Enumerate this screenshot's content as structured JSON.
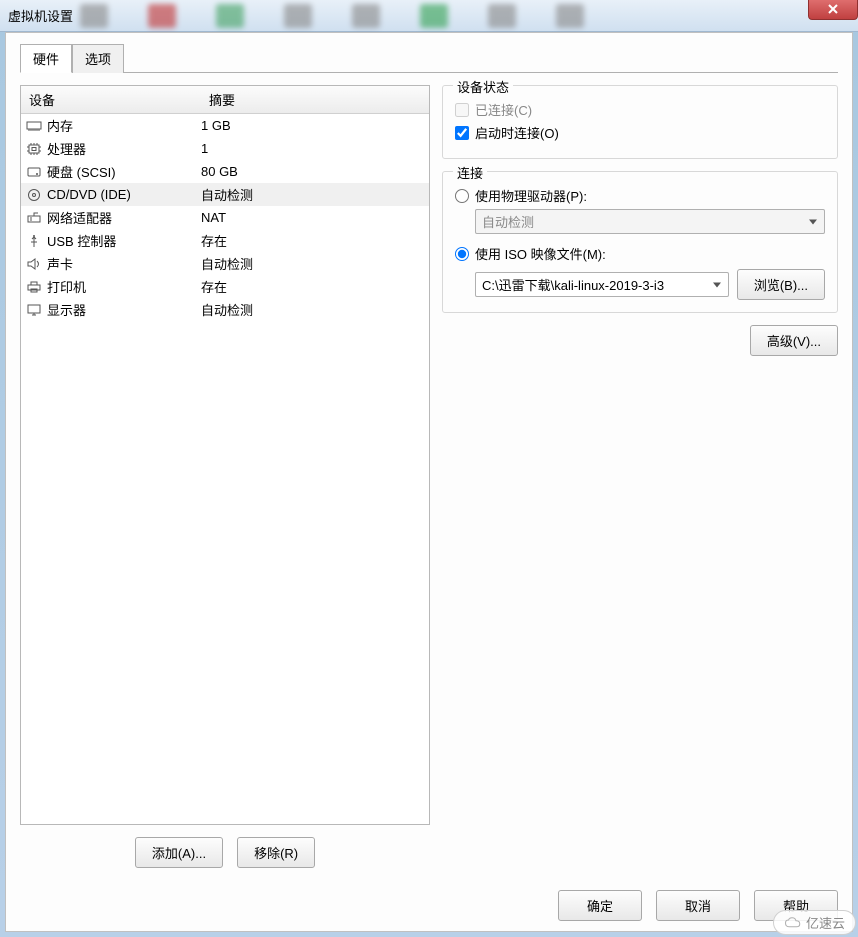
{
  "window": {
    "title": "虚拟机设置"
  },
  "tabs": {
    "hardware": "硬件",
    "options": "选项"
  },
  "deviceListHeaders": {
    "device": "设备",
    "summary": "摘要"
  },
  "devices": [
    {
      "name": "内存",
      "summary": "1 GB",
      "icon": "memory"
    },
    {
      "name": "处理器",
      "summary": "1",
      "icon": "cpu"
    },
    {
      "name": "硬盘 (SCSI)",
      "summary": "80 GB",
      "icon": "disk"
    },
    {
      "name": "CD/DVD (IDE)",
      "summary": "自动检测",
      "icon": "cd",
      "selected": true
    },
    {
      "name": "网络适配器",
      "summary": "NAT",
      "icon": "network"
    },
    {
      "name": "USB 控制器",
      "summary": "存在",
      "icon": "usb"
    },
    {
      "name": "声卡",
      "summary": "自动检测",
      "icon": "sound"
    },
    {
      "name": "打印机",
      "summary": "存在",
      "icon": "printer"
    },
    {
      "name": "显示器",
      "summary": "自动检测",
      "icon": "display"
    }
  ],
  "leftButtons": {
    "add": "添加(A)...",
    "remove": "移除(R)"
  },
  "deviceStatus": {
    "title": "设备状态",
    "connected": "已连接(C)",
    "connectAtPowerOn": "启动时连接(O)"
  },
  "connection": {
    "title": "连接",
    "usePhysical": "使用物理驱动器(P):",
    "physicalValue": "自动检测",
    "useIso": "使用 ISO 映像文件(M):",
    "isoPath": "C:\\迅雷下载\\kali-linux-2019-3-i3",
    "browse": "浏览(B)..."
  },
  "advanced": "高级(V)...",
  "footer": {
    "ok": "确定",
    "cancel": "取消",
    "help": "帮助"
  },
  "watermark": "亿速云"
}
